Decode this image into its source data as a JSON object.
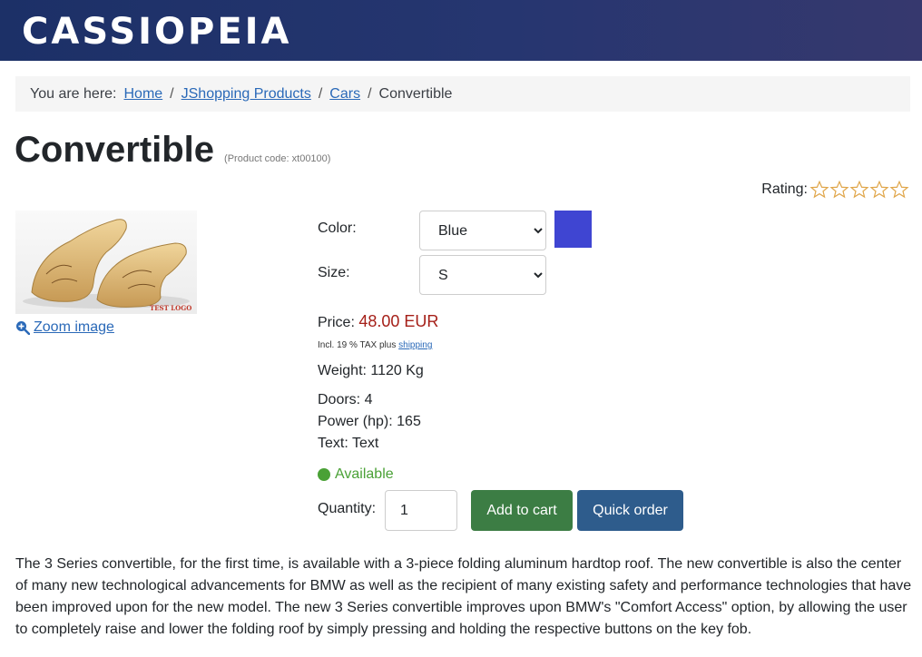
{
  "site": {
    "brand": "CASSIOPEIA"
  },
  "breadcrumb": {
    "label": "You are here:",
    "items": [
      {
        "text": "Home",
        "link": true
      },
      {
        "text": "JShopping Products",
        "link": true
      },
      {
        "text": "Cars",
        "link": true
      },
      {
        "text": "Convertible",
        "link": false
      }
    ],
    "separator": "/"
  },
  "product": {
    "title": "Convertible",
    "code": "(Product code: xt00100)",
    "rating_label": "Rating:",
    "rating_value": 0,
    "rating_max": 5,
    "image_watermark": "TEST LOGO",
    "zoom_label": "Zoom image",
    "attributes": {
      "color_label": "Color:",
      "color_value": "Blue",
      "color_swatch": "#3f45d2",
      "size_label": "Size:",
      "size_value": "S"
    },
    "price_label": "Price:",
    "price_value": "48.00 EUR",
    "tax_text": "Incl. 19 % TAX",
    "tax_plus": "plus",
    "shipping_link": "shipping",
    "weight": "Weight: 1120 Kg",
    "extra_fields": [
      "Doors: 4",
      "Power (hp): 165",
      "Text: Text"
    ],
    "availability": "Available",
    "quantity_label": "Quantity:",
    "quantity_value": "1",
    "add_to_cart": "Add to cart",
    "quick_order": "Quick order",
    "description": "The 3 Series convertible, for the first time, is available with a 3-piece folding aluminum hardtop roof. The new convertible is also the center of many new technological advancements for BMW as well as the recipient of many existing safety and performance technologies that have been improved upon for the new model. The new 3 Series convertible improves upon BMW's \"Comfort Access\" option, by allowing the user to completely raise and lower the folding roof by simply pressing and holding the respective buttons on the key fob."
  },
  "colors": {
    "header_start": "#1c3067",
    "header_end": "#36386e",
    "link": "#2a69b8",
    "price": "#a51f18",
    "available": "#4aa136",
    "cart_button": "#3c7d44",
    "quick_button": "#2e5c8c"
  },
  "icons": {
    "zoom": "zoom-in-icon",
    "star": "star-outline-icon",
    "availability": "green-dot-icon"
  }
}
